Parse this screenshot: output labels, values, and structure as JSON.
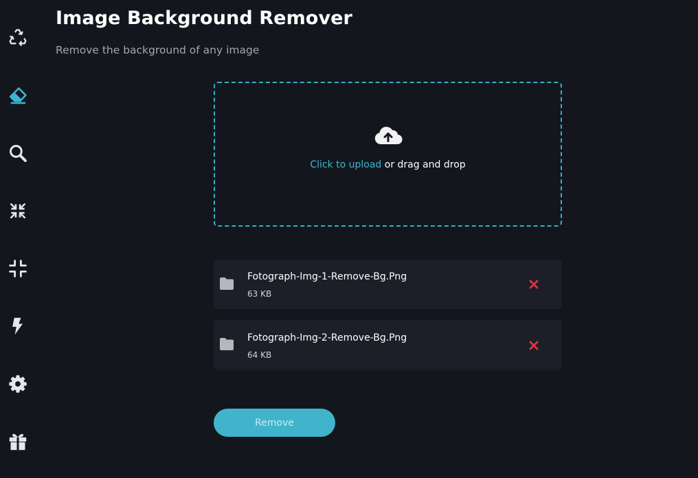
{
  "sidebar": {
    "items": [
      {
        "icon": "recycle-icon"
      },
      {
        "icon": "eraser-icon",
        "active": true
      },
      {
        "icon": "search-icon"
      },
      {
        "icon": "compress-icon"
      },
      {
        "icon": "minimize-icon"
      },
      {
        "icon": "bolt-icon"
      },
      {
        "icon": "gear-icon"
      },
      {
        "icon": "gift-icon"
      }
    ]
  },
  "header": {
    "title": "Image Background Remover",
    "subtitle": "Remove the background of any image"
  },
  "upload": {
    "icon": "cloud-upload-icon",
    "link_text": "Click to upload",
    "rest_text": " or drag and drop"
  },
  "files": [
    {
      "name": "Fotograph-Img-1-Remove-Bg.Png",
      "size": "63 KB"
    },
    {
      "name": "Fotograph-Img-2-Remove-Bg.Png",
      "size": "64 KB"
    }
  ],
  "actions": {
    "remove_label": "Remove"
  },
  "colors": {
    "background": "#14161d",
    "accent": "#40b4cb",
    "icon": "#e6e7ea",
    "danger": "#e0323f",
    "card": "#1c1f28"
  }
}
